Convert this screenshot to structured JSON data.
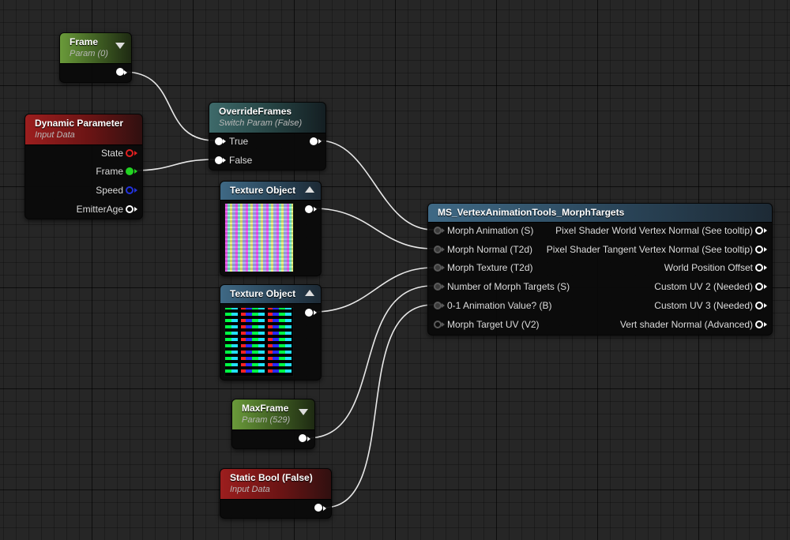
{
  "nodes": {
    "frame": {
      "title": "Frame",
      "subtitle": "Param (0)"
    },
    "dynamic": {
      "title": "Dynamic Parameter",
      "subtitle": "Input Data",
      "outputs": [
        "State",
        "Frame",
        "Speed",
        "EmitterAge"
      ]
    },
    "override": {
      "title": "OverrideFrames",
      "subtitle": "Switch Param (False)",
      "inputs": [
        "True",
        "False"
      ]
    },
    "tex1": {
      "title": "Texture Object"
    },
    "tex2": {
      "title": "Texture Object"
    },
    "maxframe": {
      "title": "MaxFrame",
      "subtitle": "Param (529)"
    },
    "staticbool": {
      "title": "Static Bool (False)",
      "subtitle": "Input Data"
    },
    "morph": {
      "title": "MS_VertexAnimationTools_MorphTargets",
      "inputs": [
        "Morph Animation (S)",
        "Morph Normal (T2d)",
        "Morph Texture (T2d)",
        "Number of Morph Targets (S)",
        "0-1 Animation Value? (B)",
        "Morph Target UV (V2)"
      ],
      "outputs": [
        "Pixel Shader World Vertex Normal (See tooltip)",
        "Pixel Shader Tangent Vertex Normal (See tooltip)",
        "World Position Offset",
        "Custom UV 2 (Needed)",
        "Custom UV 3 (Needed)",
        "Vert shader Normal (Advanced)"
      ]
    }
  },
  "colors": {
    "wire": "#e8e8e8",
    "pin_state": "#e02020",
    "pin_frame": "#22d322",
    "pin_speed": "#2233dd"
  },
  "icons": {
    "param_dropdown": "chevron-down-icon",
    "texture_collapse": "chevron-up-icon"
  }
}
